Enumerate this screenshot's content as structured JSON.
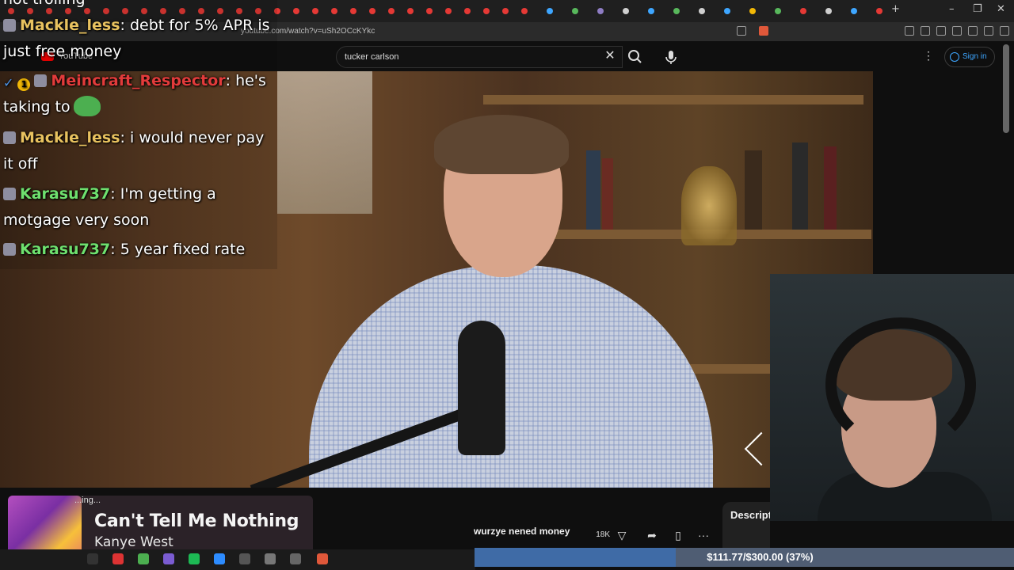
{
  "browser": {
    "url": "youtube.com/watch?v=uSh2OCcKYkc",
    "window_controls": {
      "minimize": "–",
      "maximize": "❐",
      "close": "✕",
      "new_tab": "+"
    }
  },
  "youtube": {
    "logo_text": "YouTube",
    "search_query": "tucker carlson",
    "clear_icon": "✕",
    "more_icon": "⋮",
    "sign_in_label": "Sign in",
    "video_title": "wurzye nened money",
    "like_count": "18K",
    "description_label": "Descript",
    "more_actions_icon": "···"
  },
  "chat": {
    "top_cut_text": "not trolling",
    "messages": [
      {
        "user": "Mackle_less",
        "color": "#e8c25f",
        "text": "debt for 5% APR is just free money",
        "badges": [
          "sub"
        ]
      },
      {
        "user": "Meincraft_Respector",
        "color": "#e23b3b",
        "text": "he's taking to",
        "badges": [
          "check",
          "gold",
          "sub"
        ],
        "emote": "pepe"
      },
      {
        "user": "Mackle_less",
        "color": "#e8c25f",
        "text": "i would never pay it off",
        "badges": [
          "sub"
        ]
      },
      {
        "user": "Karasu737",
        "color": "#6ee06e",
        "text": "I'm getting a motgage very soon",
        "badges": [
          "sub"
        ]
      },
      {
        "user": "Karasu737",
        "color": "#6ee06e",
        "text": "5 year fixed rate",
        "badges": [
          "sub"
        ]
      }
    ]
  },
  "now_playing": {
    "status": "...ing...",
    "title": "Can't Tell Me Nothing",
    "artist": "Kanye West"
  },
  "donation_goal": {
    "text": "$111.77/$300.00 (37%)",
    "current": 111.77,
    "target": 300.0,
    "percent": 37
  },
  "colors": {
    "accent_blue": "#3ea6ff",
    "goal_fill": "#3f6ba6",
    "goal_bg": "#4f5d73"
  }
}
